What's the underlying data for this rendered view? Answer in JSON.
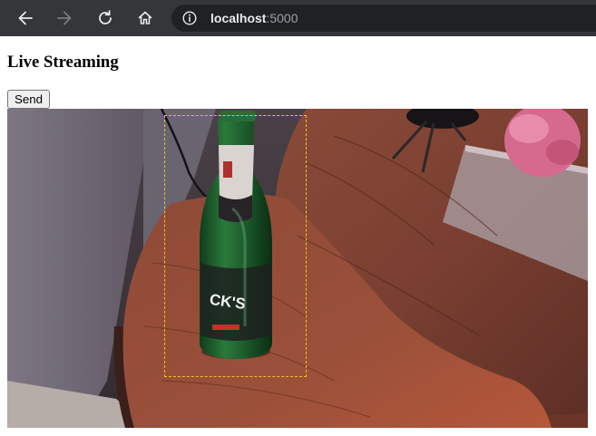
{
  "browser": {
    "url_host": "localhost",
    "url_port": ":5000",
    "icons": {
      "back": "arrow-left-icon",
      "forward": "arrow-right-icon",
      "reload": "reload-icon",
      "home": "home-icon",
      "info": "info-icon"
    },
    "colors": {
      "toolbar": "#35363a",
      "omnibox": "#202124",
      "icon": "#e8eaed",
      "icon_disabled": "#7a7b7e"
    }
  },
  "page": {
    "title": "Live Streaming",
    "send_label": "Send"
  },
  "video": {
    "colors": {
      "detection_box": "#e9c31a"
    }
  }
}
